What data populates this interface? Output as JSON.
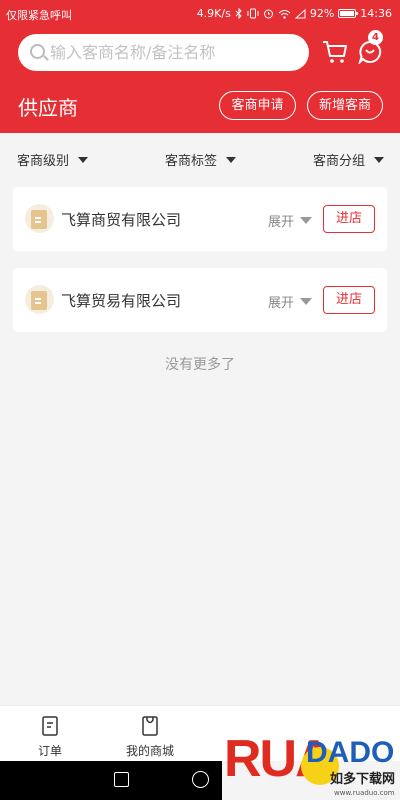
{
  "status_bar": {
    "left_text": "仅限紧急呼叫",
    "network_speed": "4.9K/s",
    "battery": "92%",
    "time": "14:36"
  },
  "header": {
    "search_placeholder": "输入客商名称/备注名称",
    "message_badge": "4",
    "title": "供应商",
    "apply_button": "客商申请",
    "new_button": "新增客商"
  },
  "filters": [
    {
      "label": "客商级别"
    },
    {
      "label": "客商标签"
    },
    {
      "label": "客商分组"
    }
  ],
  "suppliers": [
    {
      "name": "飞算商贸有限公司",
      "expand_label": "展开",
      "action_label": "进店"
    },
    {
      "name": "飞算贸易有限公司",
      "expand_label": "展开",
      "action_label": "进店"
    }
  ],
  "list_end_text": "没有更多了",
  "tabbar": {
    "items": [
      {
        "label": "订单",
        "icon": "order-icon"
      },
      {
        "label": "我的商城",
        "icon": "mall-bag-icon"
      }
    ]
  },
  "watermark": {
    "logo_text": "RUADADO",
    "tagline": "如多下载网",
    "url": "www.ruaduo.com"
  },
  "colors": {
    "brand_red": "#e62e35",
    "background": "#f4f4f4"
  }
}
